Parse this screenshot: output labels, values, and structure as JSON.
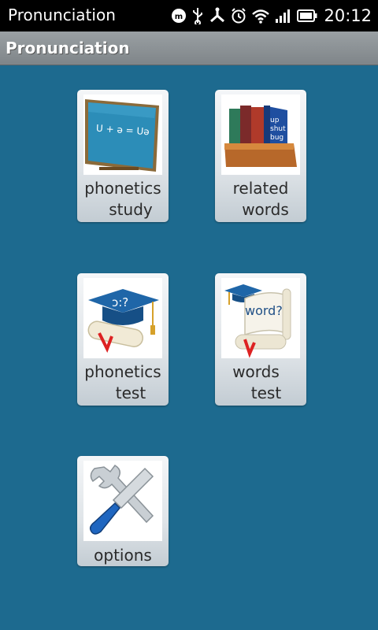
{
  "status_bar": {
    "app_name": "Pronunciation",
    "time": "20:12",
    "icons": [
      "notification-m-icon",
      "usb-icon",
      "usb-debug-icon",
      "alarm-icon",
      "wifi-icon",
      "signal-icon",
      "battery-icon"
    ]
  },
  "title_bar": {
    "title": "Pronunciation"
  },
  "tiles": [
    {
      "name": "phonetics-study",
      "line1": "phonetics",
      "line2": "study",
      "icon": "chalkboard-icon",
      "board_text": "U + ə = Uə"
    },
    {
      "name": "related-words",
      "line1": "related",
      "line2": "words",
      "icon": "books-icon",
      "book_text": [
        "up",
        "shut",
        "bug"
      ]
    },
    {
      "name": "phonetics-test",
      "line1": "phonetics",
      "line2": "test",
      "icon": "graduation-cap-icon",
      "cap_text": "ɔ:?"
    },
    {
      "name": "words-test",
      "line1": "words",
      "line2": "test",
      "icon": "diploma-icon",
      "scroll_text": "word?"
    },
    {
      "name": "options",
      "line1": "options",
      "icon": "tools-icon"
    }
  ],
  "colors": {
    "background": "#1d6a8f",
    "title_bar": "#8a9094"
  }
}
